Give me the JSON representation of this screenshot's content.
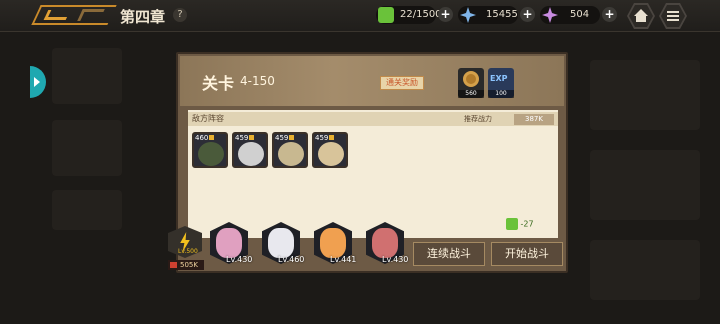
{
  "header": {
    "chapter_title": "第四章",
    "help_label": "?",
    "resources": [
      {
        "icon": "stamina-cube-icon",
        "value": "22/1500",
        "color": "#6ac23a"
      },
      {
        "icon": "crystal-star-icon",
        "value": "15455",
        "color": "#7fb4e8"
      },
      {
        "icon": "pink-star-icon",
        "value": "504",
        "color": "#c88be0"
      }
    ],
    "plus_label": "+"
  },
  "stage": {
    "label": "关卡",
    "number": "4-150",
    "first_clear_label": "通关奖励",
    "rewards": [
      {
        "icon": "gold-coin-icon",
        "amount": "560",
        "color": "#d4a04a"
      },
      {
        "icon": "exp-icon",
        "text": "EXP",
        "amount": "100",
        "color": "#3a7ac8"
      }
    ]
  },
  "enemy_section": {
    "title": "敌方阵容",
    "power_label": "推荐战力",
    "power_value": "387K",
    "enemies": [
      {
        "level": "460",
        "color": "#4a5a3a"
      },
      {
        "level": "459",
        "color": "#d0d0d0"
      },
      {
        "level": "459",
        "color": "#c8b890"
      },
      {
        "level": "459",
        "color": "#d8c49a"
      }
    ]
  },
  "stamina_cost": "-27",
  "team": {
    "leader_level": "Lv.500",
    "leader_power": "505K",
    "members": [
      {
        "level": "Lv.430",
        "color": "#e0a0c0"
      },
      {
        "level": "Lv.460",
        "color": "#e8e8ee"
      },
      {
        "level": "Lv.441",
        "color": "#f0a050"
      },
      {
        "level": "Lv.430",
        "color": "#d07070"
      }
    ]
  },
  "buttons": {
    "auto_battle": "连续战斗",
    "start_battle": "开始战斗"
  }
}
